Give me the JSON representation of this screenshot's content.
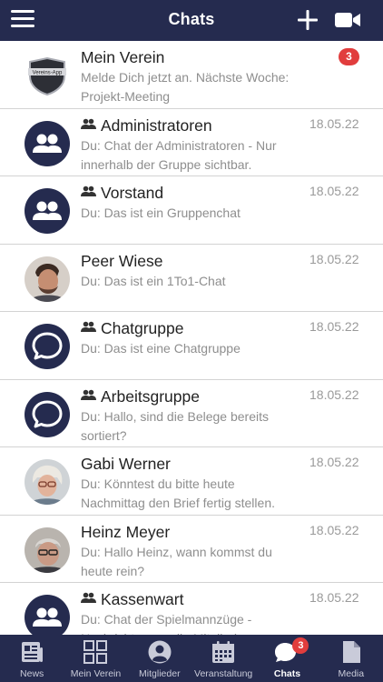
{
  "header": {
    "title": "Chats"
  },
  "chats": [
    {
      "name": "Mein Verein",
      "preview": "Melde Dich jetzt an. Nächste Woche: Projekt-Meeting",
      "date": "",
      "badge": "3",
      "logo_text": "Vereins-App"
    },
    {
      "name": "Administratoren",
      "preview": "Du: Chat der Administratoren - Nur innerhalb der Gruppe sichtbar.",
      "date": "18.05.22"
    },
    {
      "name": "Vorstand",
      "preview": "Du: Das ist ein Gruppenchat",
      "date": "18.05.22"
    },
    {
      "name": "Peer Wiese",
      "preview": "Du: Das ist ein 1To1-Chat",
      "date": "18.05.22"
    },
    {
      "name": "Chatgruppe",
      "preview": "Du: Das ist eine Chatgruppe",
      "date": "18.05.22"
    },
    {
      "name": "Arbeitsgruppe",
      "preview": "Du: Hallo, sind die Belege bereits sortiert?",
      "date": "18.05.22"
    },
    {
      "name": "Gabi Werner",
      "preview": "Du: Könntest du bitte heute Nachmittag den Brief fertig stellen.",
      "date": "18.05.22"
    },
    {
      "name": "Heinz Meyer",
      "preview": "Du: Hallo Heinz, wann kommst du heute rein?",
      "date": "18.05.22"
    },
    {
      "name": "Kassenwart",
      "preview": "Du: Chat der Spielmannzüge - Nachrichten an alle Mitglieder",
      "date": "18.05.22"
    }
  ],
  "tabs": [
    {
      "label": "News",
      "icon": "news-icon"
    },
    {
      "label": "Mein Verein",
      "icon": "grid-icon"
    },
    {
      "label": "Mitglieder",
      "icon": "person-icon"
    },
    {
      "label": "Veranstaltung",
      "icon": "calendar-icon"
    },
    {
      "label": "Chats",
      "icon": "chat-icon",
      "badge": "3"
    },
    {
      "label": "Media",
      "icon": "file-icon"
    }
  ],
  "colors": {
    "navy": "#252b4f",
    "badge_red": "#e13d3d",
    "text_gray": "#8e8e8e"
  }
}
